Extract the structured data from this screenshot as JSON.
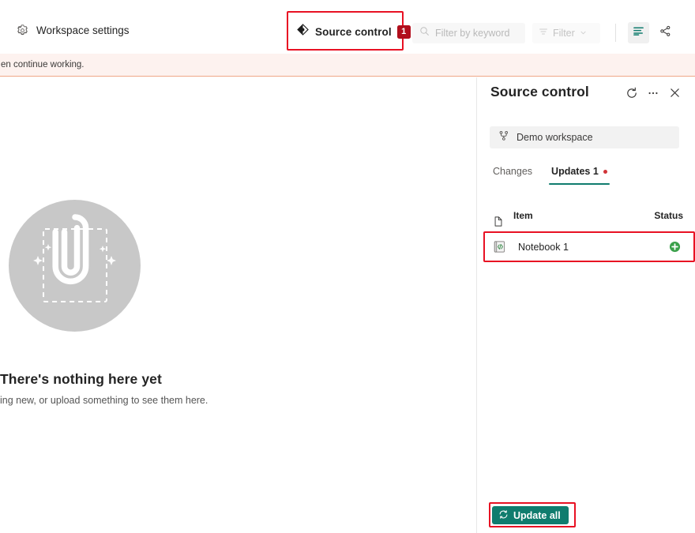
{
  "toolbar": {
    "workspace_settings_label": "Workspace settings",
    "workspace_settings_icon": "gear-icon",
    "source_control_label": "Source control",
    "source_control_icon": "source-control-diamond-icon",
    "source_control_badge": "1",
    "filter_keyword_placeholder": "Filter by keyword",
    "filter_keyword_value": "",
    "filter_keyword_icon": "search-icon",
    "filter_dropdown_label": "Filter",
    "filter_dropdown_icon": "filter-lines-icon",
    "filter_dropdown_chevron": "chevron-down-icon",
    "view_list_icon": "list-view-icon",
    "lineage_icon": "lineage-share-icon"
  },
  "banner": {
    "text": "en continue working."
  },
  "main": {
    "empty_title": "There's nothing here yet",
    "empty_subtitle": "ing new, or upload something to see them here.",
    "illustration_icon": "paperclip-upload-illustration"
  },
  "panel": {
    "title": "Source control",
    "refresh_icon": "refresh-icon",
    "more_icon": "more-horizontal-icon",
    "close_icon": "close-icon",
    "workspace_chip_label": "Demo workspace",
    "workspace_chip_icon": "branch-icon",
    "tabs": [
      {
        "label": "Changes",
        "active": false,
        "dot": false
      },
      {
        "label": "Updates 1",
        "active": true,
        "dot": true
      }
    ],
    "table": {
      "header_item": "Item",
      "header_status": "Status",
      "header_item_icon": "document-icon",
      "rows": [
        {
          "name": "Notebook 1",
          "icon": "notebook-code-icon",
          "status_icon": "green-plus-added-icon",
          "status_color": "#3aa04a"
        }
      ]
    },
    "update_all_label": "Update all",
    "update_all_icon": "refresh-icon"
  },
  "colors": {
    "accent_teal": "#107c6e",
    "highlight_red": "#e81123",
    "badge_red": "#b10e1c",
    "status_green": "#3aa04a",
    "banner_bg": "#fdf2ef",
    "banner_border": "#f0a888"
  }
}
